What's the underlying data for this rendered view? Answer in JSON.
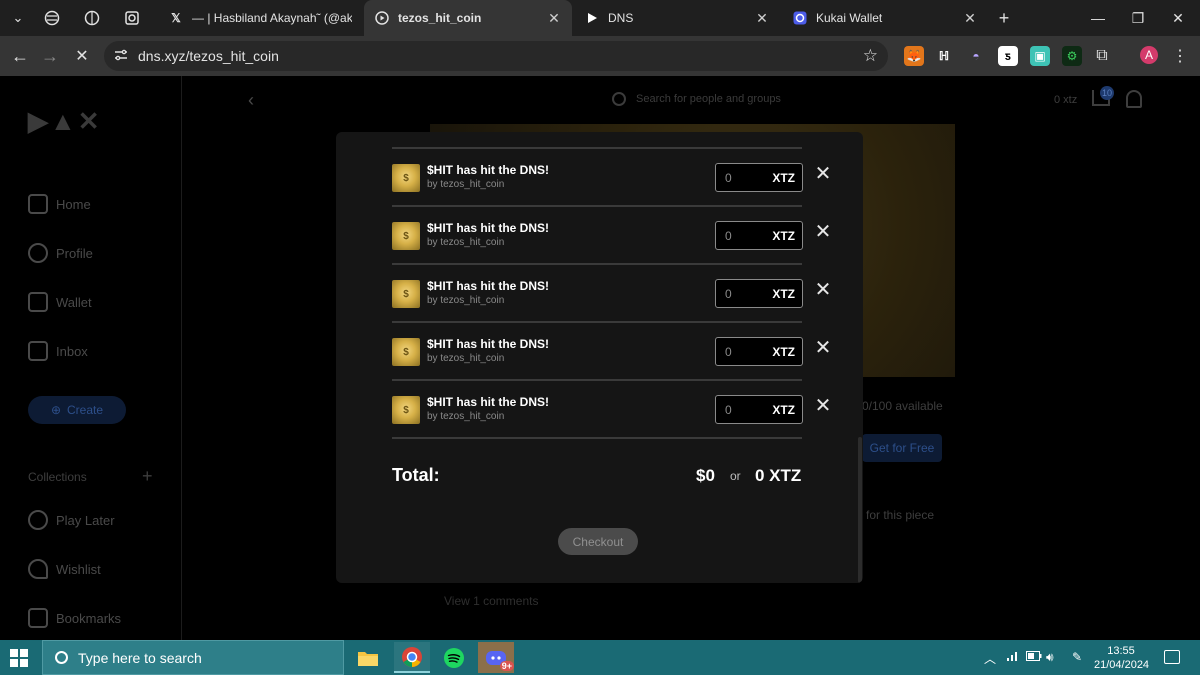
{
  "browser": {
    "tabs": [
      {
        "title": "— | Hasbiland Akaynah˜ (@ak",
        "active": false
      },
      {
        "title": "tezos_hit_coin",
        "active": true
      },
      {
        "title": "DNS",
        "active": false
      },
      {
        "title": "Kukai Wallet",
        "active": false
      }
    ],
    "url": "dns.xyz/tezos_hit_coin",
    "profile_initial": "A"
  },
  "page": {
    "search_placeholder": "Search for people and groups",
    "balance": "0 xtz",
    "cart_count": "10",
    "sidebar": {
      "items": [
        "Home",
        "Profile",
        "Wallet",
        "Inbox"
      ],
      "create_label": "Create",
      "collections_label": "Collections",
      "collection_items": [
        "Play Later",
        "Wishlist",
        "Bookmarks"
      ]
    },
    "availability": "0/100 available",
    "get_free_label": "Get for Free",
    "piece_text": "for this piece",
    "comments_text": "View 1 comments"
  },
  "cart": {
    "items": [
      {
        "title": "$HIT has hit the DNS!",
        "creator": "by tezos_hit_coin",
        "price": "0",
        "currency": "XTZ"
      },
      {
        "title": "$HIT has hit the DNS!",
        "creator": "by tezos_hit_coin",
        "price": "0",
        "currency": "XTZ"
      },
      {
        "title": "$HIT has hit the DNS!",
        "creator": "by tezos_hit_coin",
        "price": "0",
        "currency": "XTZ"
      },
      {
        "title": "$HIT has hit the DNS!",
        "creator": "by tezos_hit_coin",
        "price": "0",
        "currency": "XTZ"
      },
      {
        "title": "$HIT has hit the DNS!",
        "creator": "by tezos_hit_coin",
        "price": "0",
        "currency": "XTZ"
      }
    ],
    "total_label": "Total:",
    "total_usd": "$0",
    "or_label": "or",
    "total_xtz": "0 XTZ",
    "checkout_label": "Checkout"
  },
  "taskbar": {
    "search_placeholder": "Type here to search",
    "time": "13:55",
    "date": "21/04/2024",
    "discord_badge": "9+"
  },
  "colors": {
    "modal_bg": "#151515",
    "taskbar_bg": "#1a6a74",
    "chrome_tab_bg": "#1f1f1f",
    "chrome_toolbar_bg": "#353535"
  }
}
